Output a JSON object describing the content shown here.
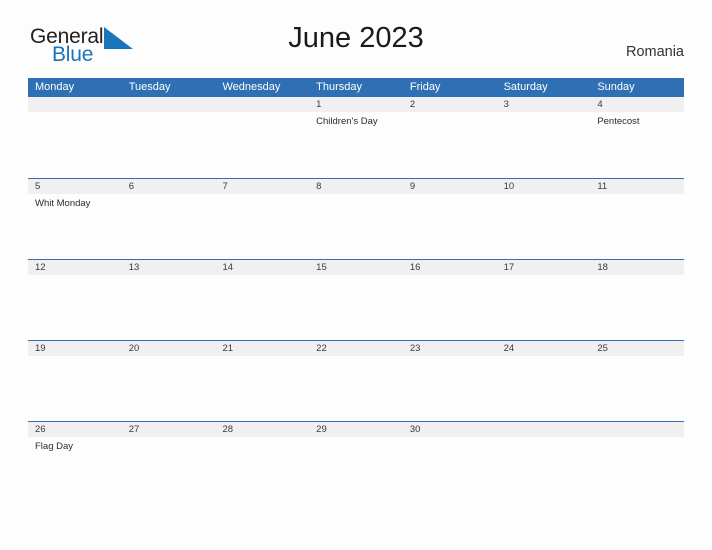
{
  "brand": {
    "name_part1": "General",
    "name_part2": "Blue",
    "mark": "blue-triangle-flag",
    "color_dark": "#231f20",
    "color_blue": "#1b75bb"
  },
  "header": {
    "title": "June 2023",
    "country": "Romania"
  },
  "theme": {
    "header_blue": "#2e70b3",
    "row_divider_blue": "#2e70b3",
    "date_strip_gray": "#f0f0f0",
    "page_background": "#fdfdfd",
    "text_dark": "#2b2b2b"
  },
  "calendar": {
    "weekdays": [
      "Monday",
      "Tuesday",
      "Wednesday",
      "Thursday",
      "Friday",
      "Saturday",
      "Sunday"
    ],
    "weeks": [
      [
        {
          "date": "",
          "events": []
        },
        {
          "date": "",
          "events": []
        },
        {
          "date": "",
          "events": []
        },
        {
          "date": "1",
          "events": [
            "Children's Day"
          ]
        },
        {
          "date": "2",
          "events": []
        },
        {
          "date": "3",
          "events": []
        },
        {
          "date": "4",
          "events": [
            "Pentecost"
          ]
        }
      ],
      [
        {
          "date": "5",
          "events": [
            "Whit Monday"
          ]
        },
        {
          "date": "6",
          "events": []
        },
        {
          "date": "7",
          "events": []
        },
        {
          "date": "8",
          "events": []
        },
        {
          "date": "9",
          "events": []
        },
        {
          "date": "10",
          "events": []
        },
        {
          "date": "11",
          "events": []
        }
      ],
      [
        {
          "date": "12",
          "events": []
        },
        {
          "date": "13",
          "events": []
        },
        {
          "date": "14",
          "events": []
        },
        {
          "date": "15",
          "events": []
        },
        {
          "date": "16",
          "events": []
        },
        {
          "date": "17",
          "events": []
        },
        {
          "date": "18",
          "events": []
        }
      ],
      [
        {
          "date": "19",
          "events": []
        },
        {
          "date": "20",
          "events": []
        },
        {
          "date": "21",
          "events": []
        },
        {
          "date": "22",
          "events": []
        },
        {
          "date": "23",
          "events": []
        },
        {
          "date": "24",
          "events": []
        },
        {
          "date": "25",
          "events": []
        }
      ],
      [
        {
          "date": "26",
          "events": [
            "Flag Day"
          ]
        },
        {
          "date": "27",
          "events": []
        },
        {
          "date": "28",
          "events": []
        },
        {
          "date": "29",
          "events": []
        },
        {
          "date": "30",
          "events": []
        },
        {
          "date": "",
          "events": []
        },
        {
          "date": "",
          "events": []
        }
      ]
    ]
  }
}
